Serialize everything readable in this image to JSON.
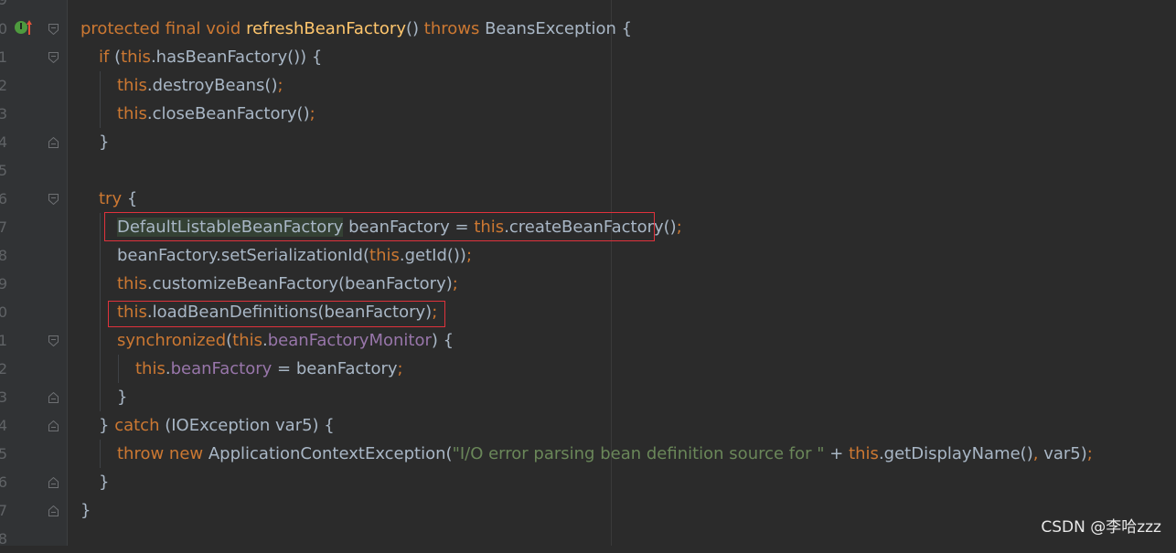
{
  "gutter": {
    "line_numbers": [
      "9",
      "0",
      "1",
      "2",
      "3",
      "4",
      "5",
      "6",
      "7",
      "8",
      "9",
      "0",
      "1",
      "2",
      "3",
      "4",
      "5",
      "6",
      "7",
      "8"
    ],
    "override_badge": "I"
  },
  "code": {
    "l1": {
      "a": "protected final void ",
      "b": "refreshBeanFactory",
      "c": "() ",
      "d": "throws ",
      "e": "BeansException {"
    },
    "l2": {
      "a": "if ",
      "b": "(",
      "c": "this",
      "d": ".hasBeanFactory()) {"
    },
    "l3": {
      "a": "this",
      "b": ".destroyBeans()",
      "c": ";"
    },
    "l4": {
      "a": "this",
      "b": ".closeBeanFactory()",
      "c": ";"
    },
    "l5": {
      "a": "}"
    },
    "l7": {
      "a": "try ",
      "b": "{"
    },
    "l8": {
      "a": "DefaultListableBeanFactory",
      "b": " beanFactory = ",
      "c": "this",
      "d": ".createBeanFactory()",
      "e": ";"
    },
    "l9": {
      "a": "beanFactory.setSerializationId(",
      "b": "this",
      "c": ".getId())",
      "d": ";"
    },
    "l10": {
      "a": "this",
      "b": ".customizeBeanFactory(beanFactory)",
      "c": ";"
    },
    "l11": {
      "a": "this",
      "b": ".loadBeanDefinitions(beanFactory)",
      "c": ";"
    },
    "l12": {
      "a": "synchronized",
      "b": "(",
      "c": "this",
      "d": ".",
      "e": "beanFactoryMonitor",
      "f": ") {"
    },
    "l13": {
      "a": "this",
      "b": ".",
      "c": "beanFactory",
      "d": " = beanFactory",
      "e": ";"
    },
    "l14": {
      "a": "}"
    },
    "l15": {
      "a": "} ",
      "b": "catch ",
      "c": "(IOException var5) {"
    },
    "l16": {
      "a": "throw new ",
      "b": "ApplicationContextException(",
      "c": "\"I/O error parsing bean definition source for \"",
      "d": " + ",
      "e": "this",
      "f": ".getDisplayName()",
      "g": ", ",
      "h": "var5)",
      "i": ";"
    },
    "l17": {
      "a": "}"
    },
    "l18": {
      "a": "}"
    }
  },
  "watermark": "CSDN @李哈zzz",
  "colors": {
    "background": "#2b2b2b",
    "keyword": "#cc7832",
    "method_decl": "#ffc66d",
    "field": "#9876aa",
    "string": "#6a8759",
    "plain": "#a9b7c6",
    "annotation_box": "#e0323c"
  }
}
